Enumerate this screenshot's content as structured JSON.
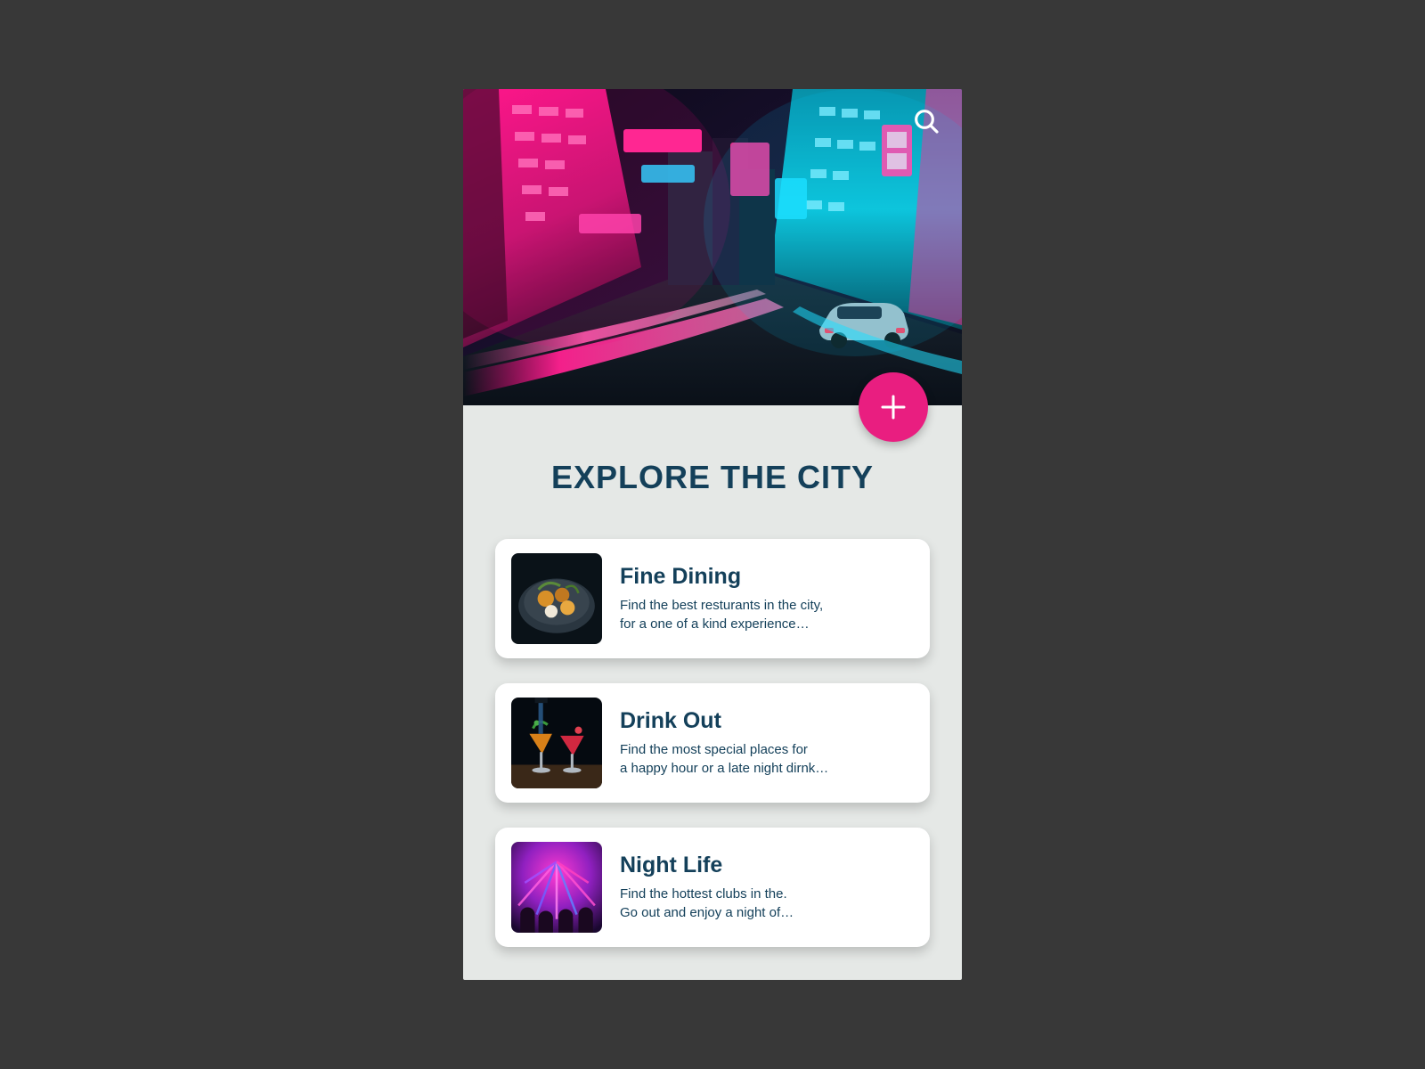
{
  "header": {
    "title": "EXPLORE THE CITY"
  },
  "cards": [
    {
      "title": "Fine Dining",
      "desc": "Find the best resturants in the city,\nfor a one of a kind experience…"
    },
    {
      "title": "Drink Out",
      "desc": "Find the most special places for\na happy hour or a late night dirnk…"
    },
    {
      "title": "Night Life",
      "desc": "Find the hottest clubs in the.\nGo out and enjoy a night of…"
    }
  ],
  "colors": {
    "accent": "#e91e80",
    "text": "#14405a"
  }
}
